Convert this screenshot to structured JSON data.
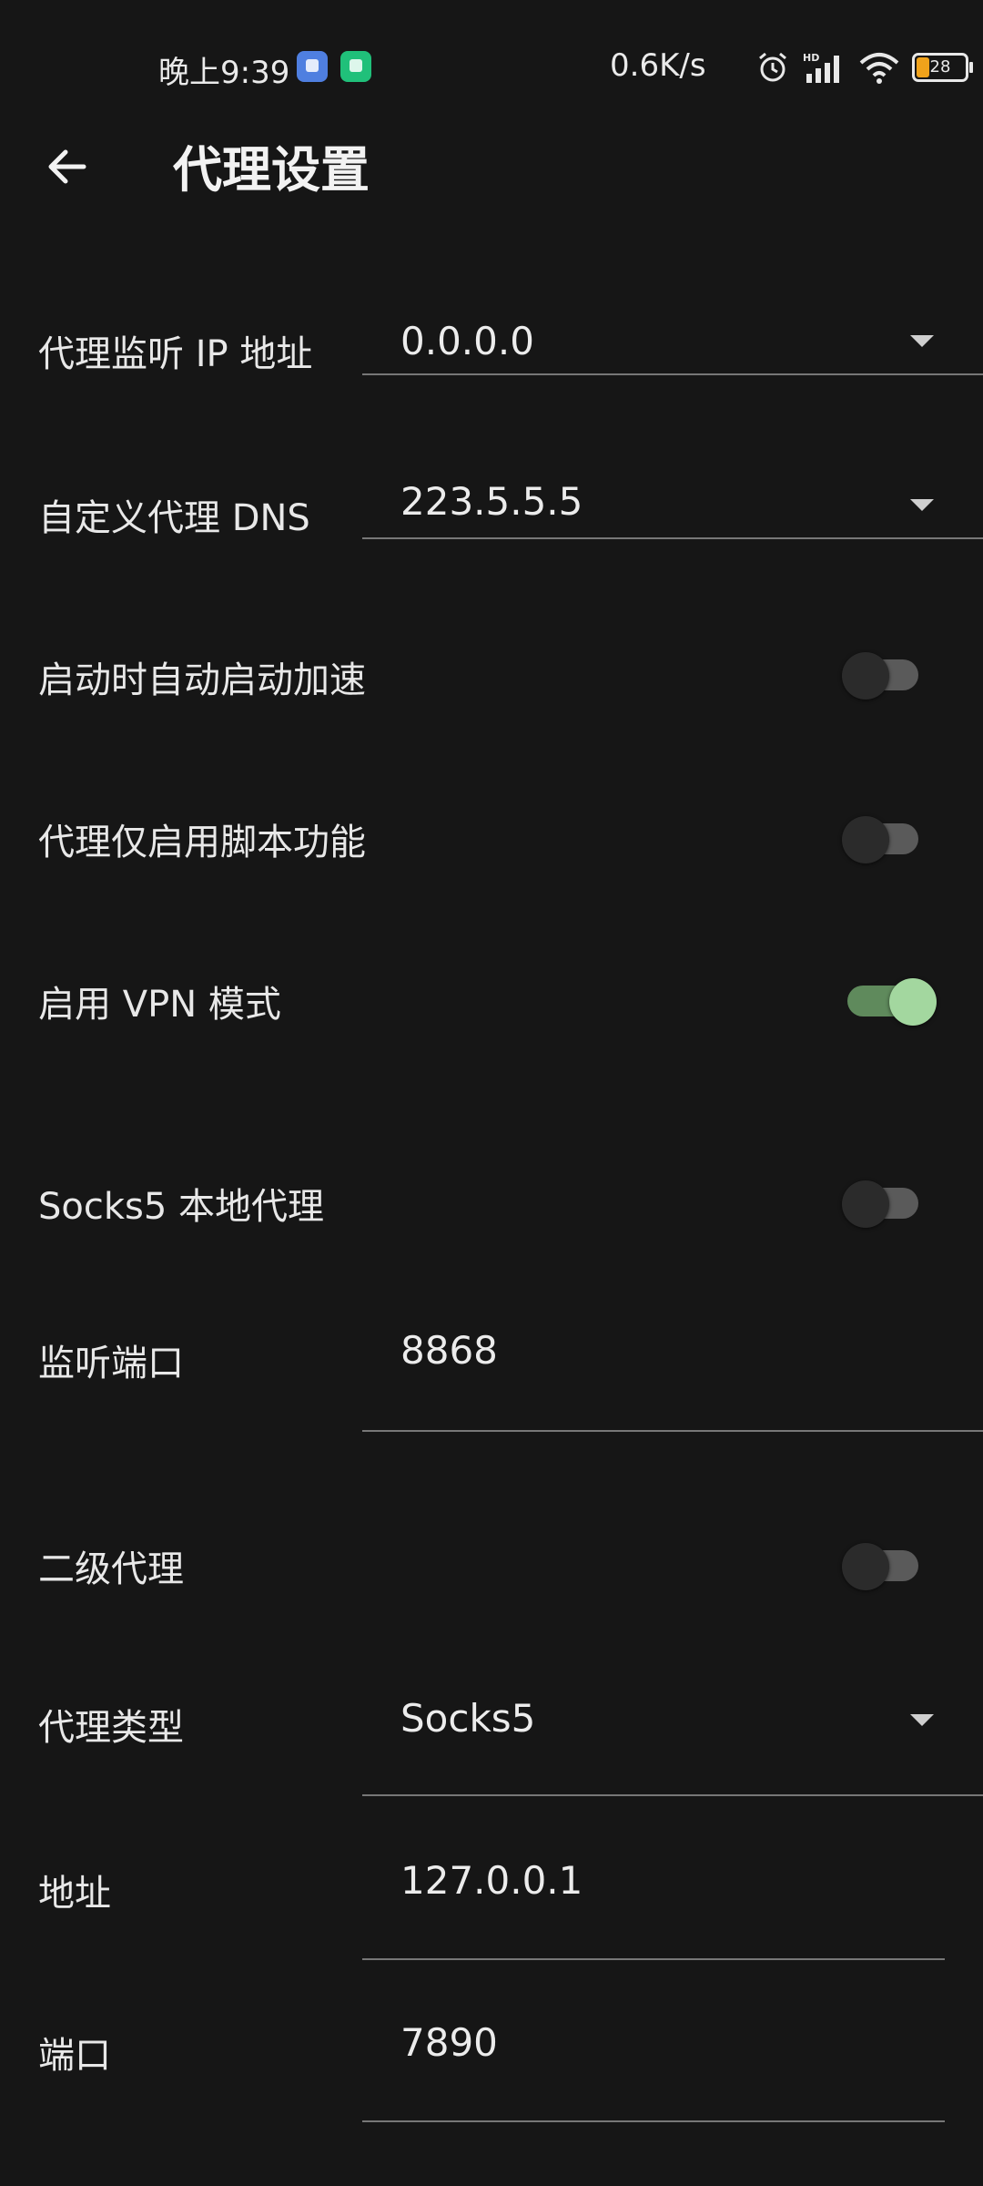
{
  "status_bar": {
    "time": "晚上9:39",
    "network_speed": "0.6K/s",
    "battery_level": "28",
    "icons": [
      "app-notification-icon",
      "shield-app-icon",
      "alarm-icon",
      "hd-signal-icon",
      "wifi-icon",
      "battery-icon"
    ]
  },
  "app_bar": {
    "title": "代理设置",
    "back_icon": "arrow-left-icon"
  },
  "settings": {
    "listen_ip": {
      "label": "代理监听 IP 地址",
      "value": "0.0.0.0"
    },
    "custom_dns": {
      "label": "自定义代理 DNS",
      "value": "223.5.5.5"
    },
    "auto_start": {
      "label": "启动时自动启动加速",
      "enabled": false
    },
    "script_only": {
      "label": "代理仅启用脚本功能",
      "enabled": false
    },
    "vpn_mode": {
      "label": "启用 VPN 模式",
      "enabled": true
    },
    "socks5_local": {
      "label": "Socks5 本地代理",
      "enabled": false
    },
    "listen_port": {
      "label": "监听端口",
      "value": "8868"
    },
    "secondary_proxy": {
      "label": "二级代理",
      "enabled": false
    },
    "proxy_type": {
      "label": "代理类型",
      "value": "Socks5"
    },
    "address": {
      "label": "地址",
      "value": "127.0.0.1"
    },
    "port": {
      "label": "端口",
      "value": "7890"
    }
  },
  "colors": {
    "background": "#161616",
    "switch_on_thumb": "#a3d79f",
    "switch_on_track": "#5f8a5c",
    "switch_off_track": "#5a5a5a",
    "underline": "#777777"
  }
}
